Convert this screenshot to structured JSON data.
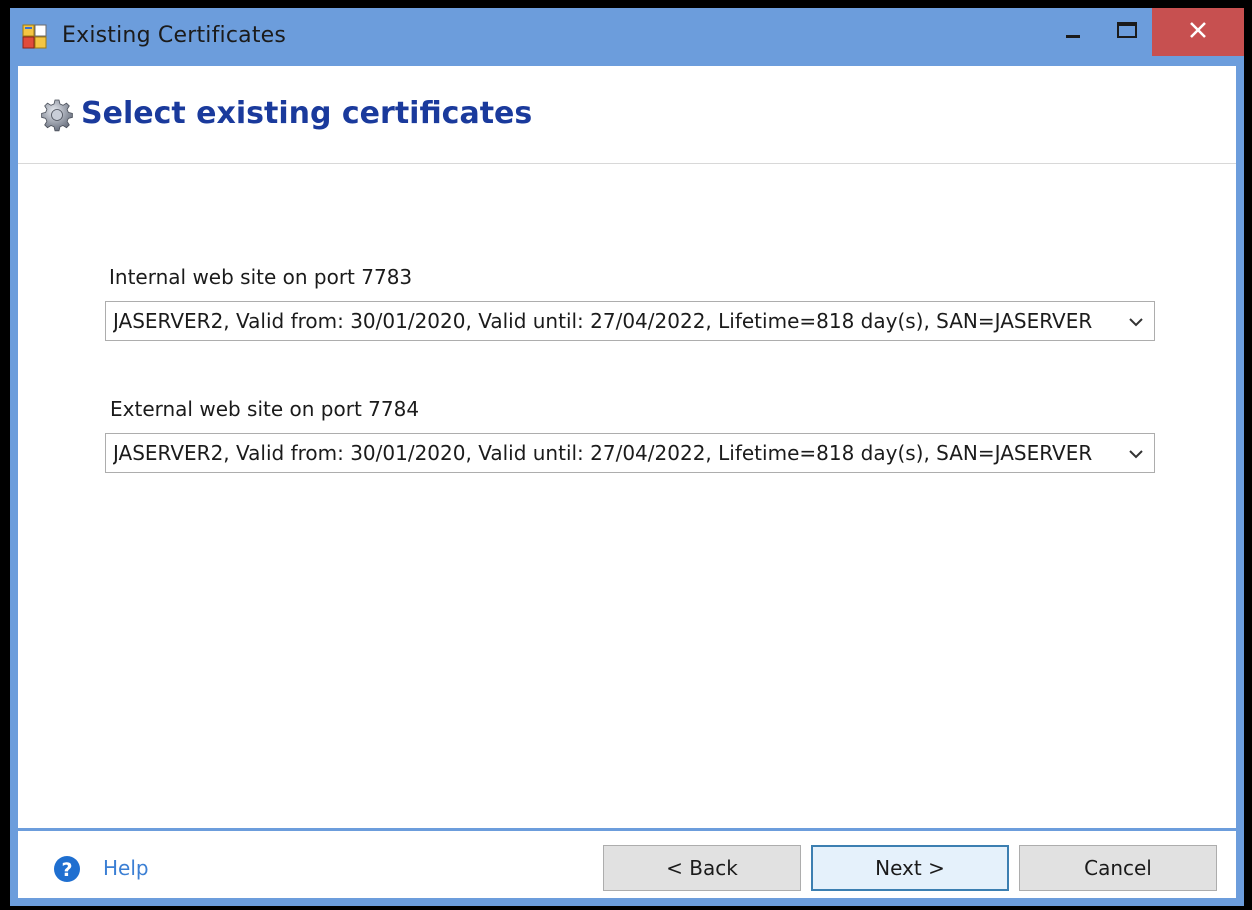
{
  "window": {
    "title": "Existing Certificates"
  },
  "header": {
    "title": "Select existing certificates"
  },
  "fields": [
    {
      "label": "Internal web site on port 7783",
      "value": "JASERVER2, Valid from: 30/01/2020, Valid until: 27/04/2022, Lifetime=818 day(s), SAN=JASERVER"
    },
    {
      "label": "External web site on port 7784",
      "value": "JASERVER2, Valid from: 30/01/2020, Valid until: 27/04/2022, Lifetime=818 day(s), SAN=JASERVER"
    }
  ],
  "footer": {
    "help_label": "Help",
    "back_label": "<  Back",
    "next_label": "Next  >",
    "cancel_label": "Cancel"
  },
  "colors": {
    "title_bar": "#6c9ddc",
    "close_button": "#c75050",
    "heading": "#1a3a9c",
    "link": "#3b7fd4",
    "default_button_border": "#3c7fb1"
  },
  "icons": {
    "app": "app-window-icon",
    "header": "gear-icon",
    "help": "help-icon",
    "minimize": "minimize-icon",
    "maximize": "maximize-icon",
    "close": "close-icon",
    "dropdown": "chevron-down-icon"
  }
}
